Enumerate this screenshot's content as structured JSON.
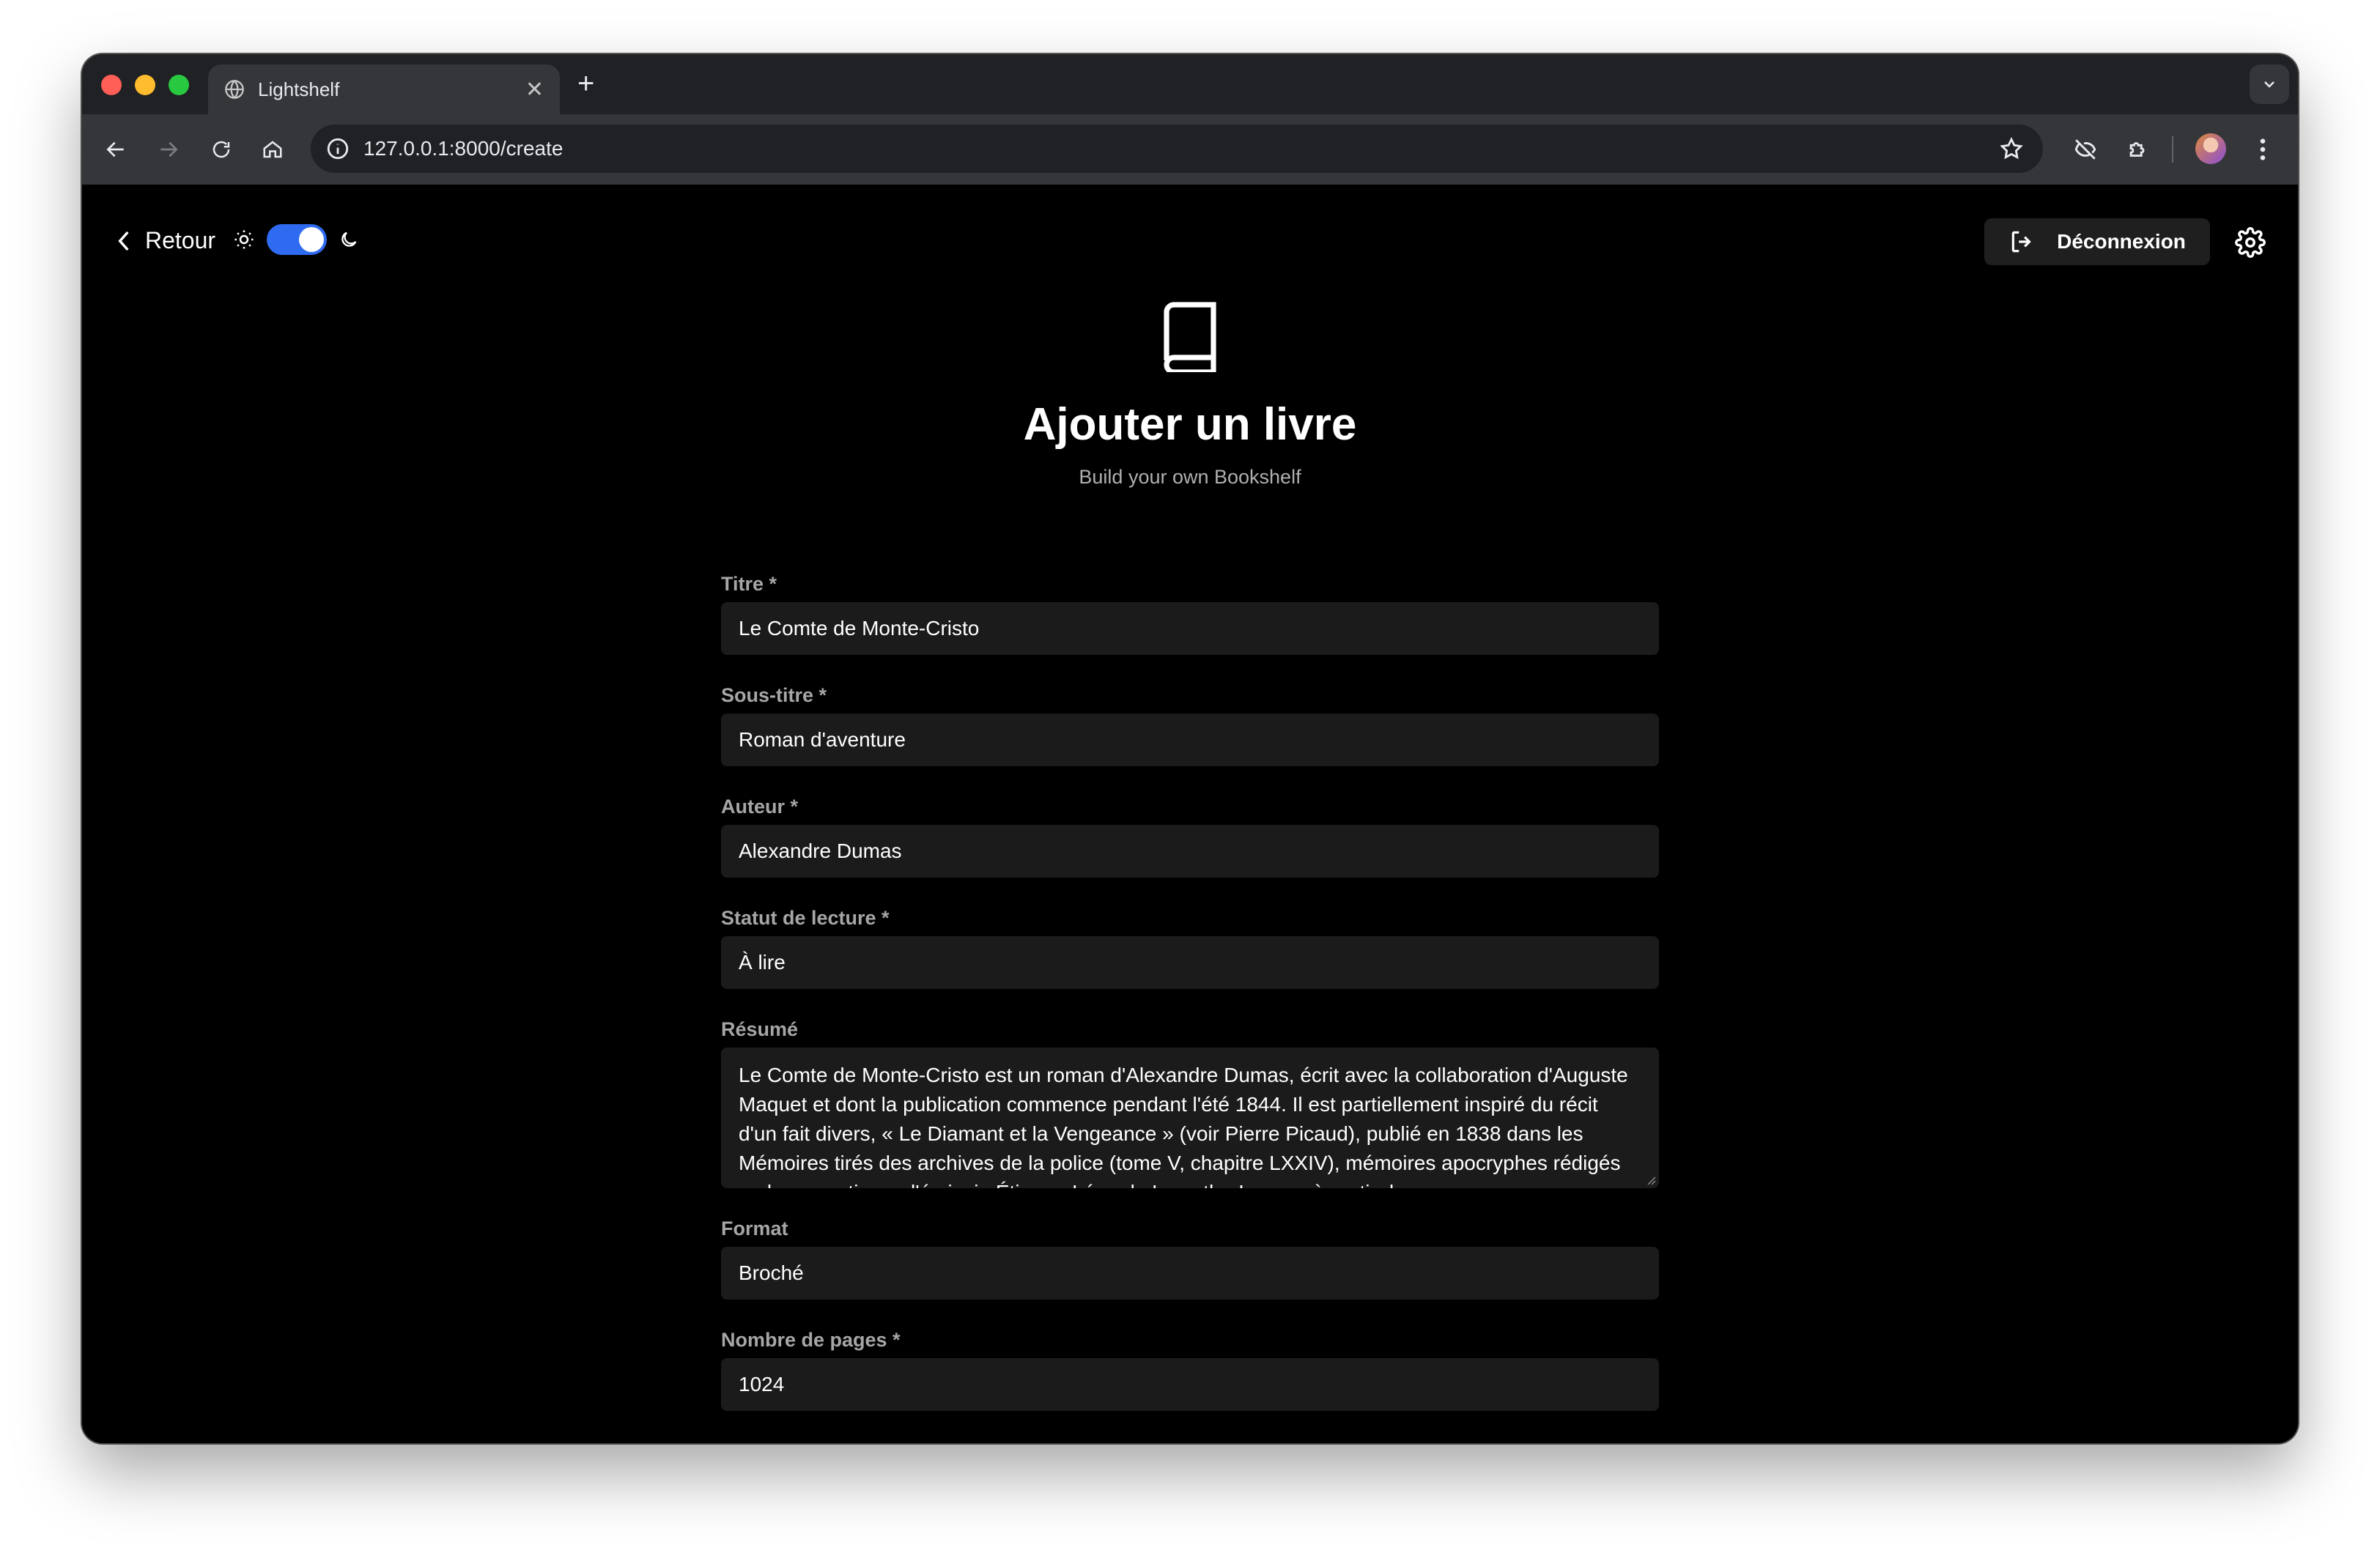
{
  "browser": {
    "tab_title": "Lightshelf",
    "url": "127.0.0.1:8000/create"
  },
  "header": {
    "back_label": "Retour",
    "logout_label": "Déconnexion",
    "theme_toggle_on": true
  },
  "hero": {
    "title": "Ajouter un livre",
    "subtitle": "Build your own Bookshelf"
  },
  "form": {
    "titre": {
      "label": "Titre *",
      "value": "Le Comte de Monte-Cristo"
    },
    "sous_titre": {
      "label": "Sous-titre *",
      "value": "Roman d'aventure"
    },
    "auteur": {
      "label": "Auteur *",
      "value": "Alexandre Dumas"
    },
    "statut": {
      "label": "Statut de lecture *",
      "value": "À lire"
    },
    "resume": {
      "label": "Résumé",
      "value": "Le Comte de Monte-Cristo est un roman d'Alexandre Dumas, écrit avec la collaboration d'Auguste Maquet et dont la publication commence pendant l'été 1844. Il est partiellement inspiré du récit d'un fait divers, « Le Diamant et la Vengeance » (voir Pierre Picaud), publié en 1838 dans les Mémoires tirés des archives de la police (tome V, chapitre LXXIV), mémoires apocryphes rédigés en large partie par l'écrivain Étienne-Léon de Lamothe-Langon à partir des"
    },
    "format": {
      "label": "Format",
      "value": "Broché"
    },
    "pages": {
      "label": "Nombre de pages *",
      "value": "1024"
    }
  },
  "colors": {
    "accent": "#2f6bf0",
    "page_bg": "#000000",
    "input_bg": "#1b1b1b"
  }
}
